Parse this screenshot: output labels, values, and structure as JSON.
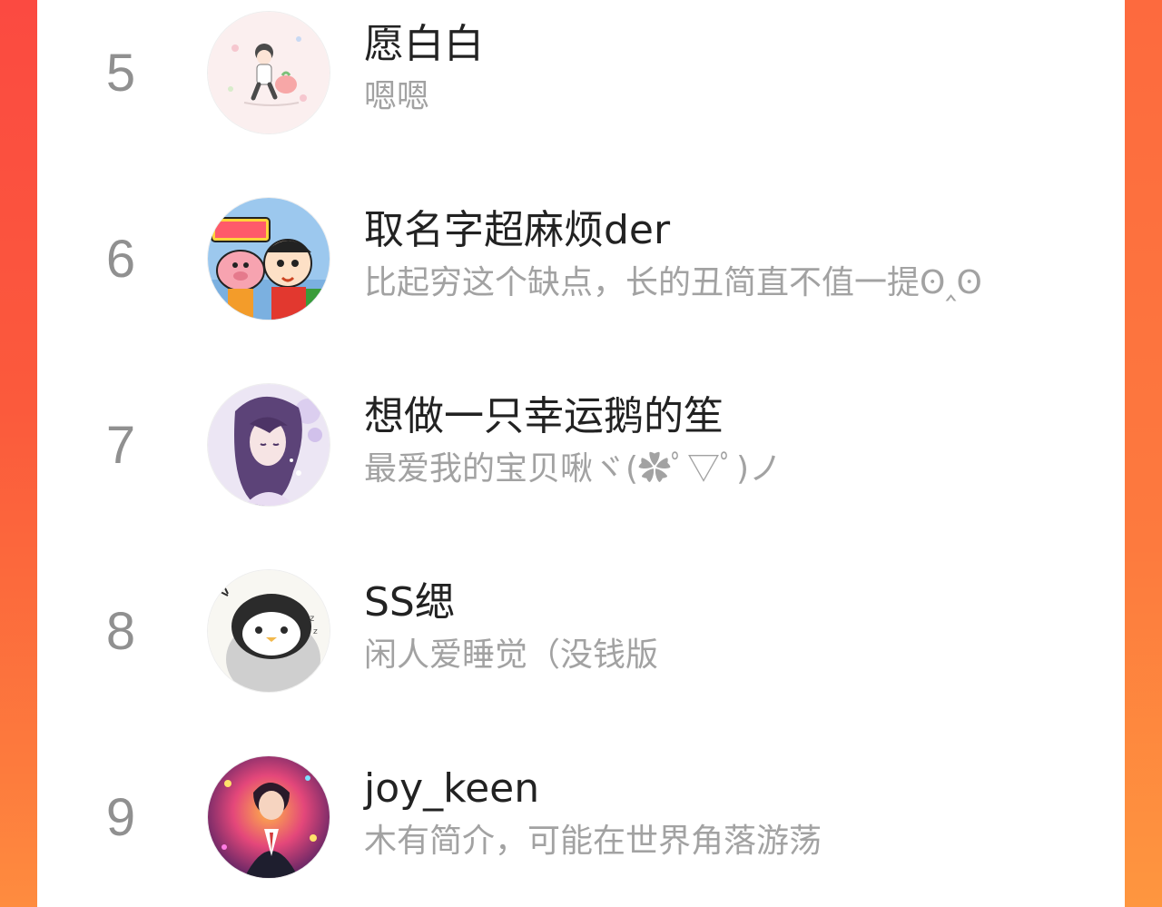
{
  "colors": {
    "accent_left": "#fb4a41",
    "accent_right": "#fe8c3f",
    "panel_bg": "#ffffff",
    "name_text": "#222222",
    "bio_text": "#a2a2a2",
    "rank_text": "#909090"
  },
  "ranking": {
    "items": [
      {
        "rank": "5",
        "name": "愿白白",
        "bio": "嗯嗯"
      },
      {
        "rank": "6",
        "name": "取名字超麻烦der",
        "bio": "比起穷这个缺点，长的丑简直不值一提ʘ‸ʘ"
      },
      {
        "rank": "7",
        "name": "想做一只幸运鹅的笙",
        "bio": "最爱我的宝贝啾ヾ(✿ﾟ▽ﾟ)ノ"
      },
      {
        "rank": "8",
        "name": "SS缌",
        "bio": "闲人爱睡觉（没钱版"
      },
      {
        "rank": "9",
        "name": "joy_keen",
        "bio": "木有简介，可能在世界角落游荡"
      }
    ]
  }
}
